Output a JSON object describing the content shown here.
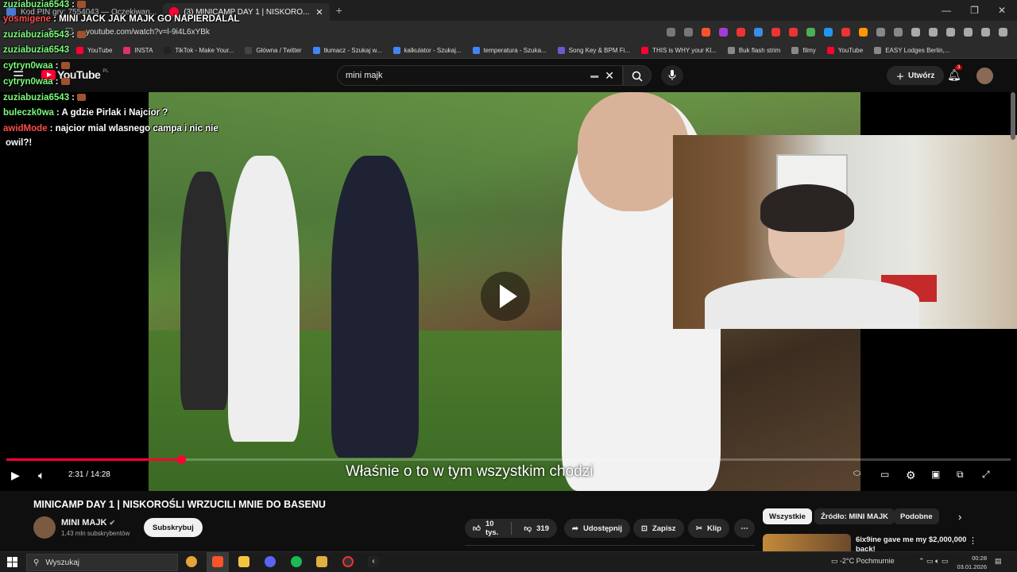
{
  "browser": {
    "tabs": [
      {
        "title": "Kod PIN gry: 7554043 — Oczekiwan...",
        "favicon_color": "#4a7bd1",
        "active": false
      },
      {
        "title": "(3) MINICAMP DAY 1 | NISKORO...",
        "favicon_color": "#ff0033",
        "active": true
      }
    ],
    "new_tab": "+",
    "url": "youtube.com/watch?v=l-9i4L6xYBk",
    "bookmarks": [
      {
        "label": "YouTube",
        "color": "#ff0033"
      },
      {
        "label": "INSTA",
        "color": "#e1306c"
      },
      {
        "label": "TikTok - Make Your...",
        "color": "#222222"
      },
      {
        "label": "Główna / Twitter",
        "color": "#444444"
      },
      {
        "label": "tłumacz - Szukaj w...",
        "color": "#4285f4"
      },
      {
        "label": "kalkulator - Szukaj...",
        "color": "#4285f4"
      },
      {
        "label": "temperatura - Szuka...",
        "color": "#4285f4"
      },
      {
        "label": "Song Key & BPM Fi...",
        "color": "#6a5acd"
      },
      {
        "label": "THIS is WHY your Kl...",
        "color": "#ff0033"
      },
      {
        "label": "Buk flash strim",
        "color": "#888888"
      },
      {
        "label": "filmy",
        "color": "#888888"
      },
      {
        "label": "YouTube",
        "color": "#ff0033"
      },
      {
        "label": "EASY Lodges Berlin,...",
        "color": "#888888"
      }
    ]
  },
  "youtube": {
    "logo_text": "YouTube",
    "country": "PL",
    "search_value": "mini majk",
    "create_label": "Utwórz",
    "notifications": "3"
  },
  "chat": [
    {
      "user": "zuziabuzia6543",
      "text": ":",
      "red": false
    },
    {
      "user": "yosmigene",
      "text": ": MINI JACK JAK MAJK GO NAPIERDALAL",
      "red": true
    },
    {
      "user": "zuziabuzia6543",
      "text": ":",
      "red": false
    },
    {
      "user": "zuziabuzia6543",
      "text": "",
      "red": false
    },
    {
      "user": "cytryn0waa",
      "text": ":",
      "red": false
    },
    {
      "user": "cytryn0waa",
      "text": ":",
      "red": false
    },
    {
      "user": "zuziabuzia6543",
      "text": ":",
      "red": false
    },
    {
      "user": "buleczk0wa",
      "text": ": A gdzie Pirlak i Najcior ?",
      "red": false
    },
    {
      "user": "awidMode",
      "text": ": najcior mial wlasnego campa i nic nie",
      "red": true
    },
    {
      "user": "",
      "text": "owil?!",
      "red": false
    }
  ],
  "player": {
    "subtitle": "Właśnie o to w tym wszystkim chodzi",
    "time_current": "2:31",
    "time_total": "14:28",
    "progress": 0.174
  },
  "video": {
    "title": "MINICAMP DAY 1 | NISKOROŚLI WRZUCILI MNIE DO BASENU",
    "channel": "MINI MAJK",
    "subscribers": "1,43 mln subskrybentów",
    "subscribe_label": "Subskrybuj",
    "likes": "10 tys.",
    "dislikes": "319",
    "share_label": "Udostępnij",
    "save_label": "Zapisz",
    "clip_label": "Klip",
    "more_label": "⋯"
  },
  "recommendations": {
    "chips": [
      "Wszystkie",
      "Źródło: MINI MAJK",
      "Podobne"
    ],
    "first_title": "6ix9ine gave me my $2,000,000 back!"
  },
  "taskbar": {
    "search_placeholder": "Wyszukaj",
    "weather": "-2°C  Pochmurnie",
    "time": "00:28",
    "date": "03.01.2026"
  }
}
